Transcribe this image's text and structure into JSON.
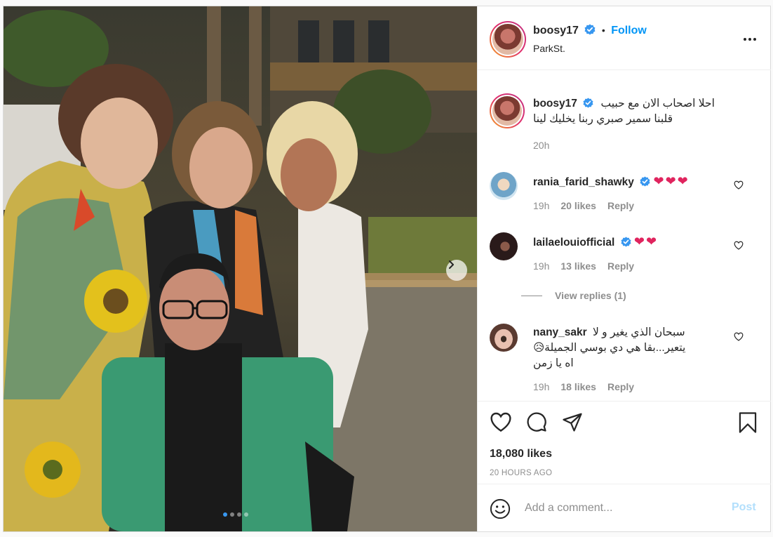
{
  "header": {
    "username": "boosy17",
    "separator": "•",
    "follow_label": "Follow",
    "location": "ParkSt.",
    "more_icon": "more-options-icon"
  },
  "carousel": {
    "slide_count": 4,
    "active_index": 0
  },
  "caption": {
    "username": "boosy17",
    "line1": "احلا اصحاب الان مع حبيب",
    "line2": "قلبنا سمير صبري ربنا يخليك لينا",
    "time": "20h"
  },
  "comments": [
    {
      "username": "rania_farid_shawky",
      "verified": true,
      "text": "❤❤❤",
      "time": "19h",
      "likes": "20 likes",
      "reply": "Reply"
    },
    {
      "username": "lailaelouiofficial",
      "verified": true,
      "text": "❤❤",
      "time": "19h",
      "likes": "13 likes",
      "reply": "Reply",
      "view_replies": "View replies (1)"
    },
    {
      "username": "nany_sakr",
      "verified": false,
      "line1": "سبحان الذي يغير و لا",
      "line2": "يتعير...بقا هي دي بوسي الجميلة😥",
      "line3": "اه يا زمن",
      "time": "19h",
      "likes": "18 likes",
      "reply": "Reply"
    }
  ],
  "actions": {
    "like_icon": "heart-icon",
    "comment_icon": "comment-icon",
    "share_icon": "paper-plane-icon",
    "save_icon": "bookmark-icon",
    "likes_count": "18,080 likes",
    "posted_ago": "20 HOURS AGO"
  },
  "composer": {
    "placeholder": "Add a comment...",
    "post_label": "Post"
  },
  "colors": {
    "accent": "#0095f6",
    "verified": "#3897f0",
    "heart": "#e0245e",
    "muted": "#8e8e8e"
  }
}
